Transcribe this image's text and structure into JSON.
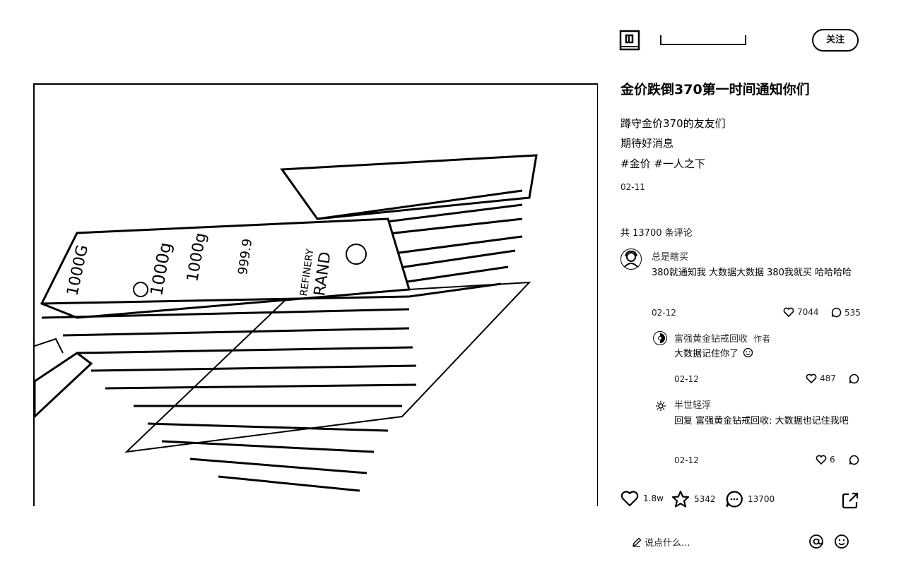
{
  "author": {
    "name": "",
    "follow_label": "关注"
  },
  "post": {
    "title": "金价跌倒370第一时间通知你们",
    "desc_lines": [
      "蹲守金价370的友友们",
      "期待好消息",
      "#金价 #一人之下"
    ],
    "date": "02-11"
  },
  "comments_header": "共 13700 条评论",
  "comments": [
    {
      "user": "总是瞎买",
      "text": "380就通知我 大数据大数据 380我就买 哈哈哈哈",
      "date": "02-12",
      "likes": "7044",
      "replies": "535"
    },
    {
      "user": "富强黄金钻戒回收",
      "author_tag": "作者",
      "text": "大数据记住你了",
      "date": "02-12",
      "likes": "487"
    },
    {
      "user": "半世轻浮",
      "text": "回复 富强黄金钻戒回收: 大数据也记住我吧",
      "date": "02-12",
      "likes": "6"
    }
  ],
  "actions": {
    "likes": "1.8w",
    "stars": "5342",
    "comments": "13700"
  },
  "input": {
    "placeholder": "说点什么..."
  },
  "icons": {
    "like": "heart-icon",
    "star": "star-icon",
    "comment": "comment-icon",
    "share": "share-icon",
    "at": "at-icon",
    "emoji": "emoji-icon",
    "edit": "pencil-icon"
  }
}
